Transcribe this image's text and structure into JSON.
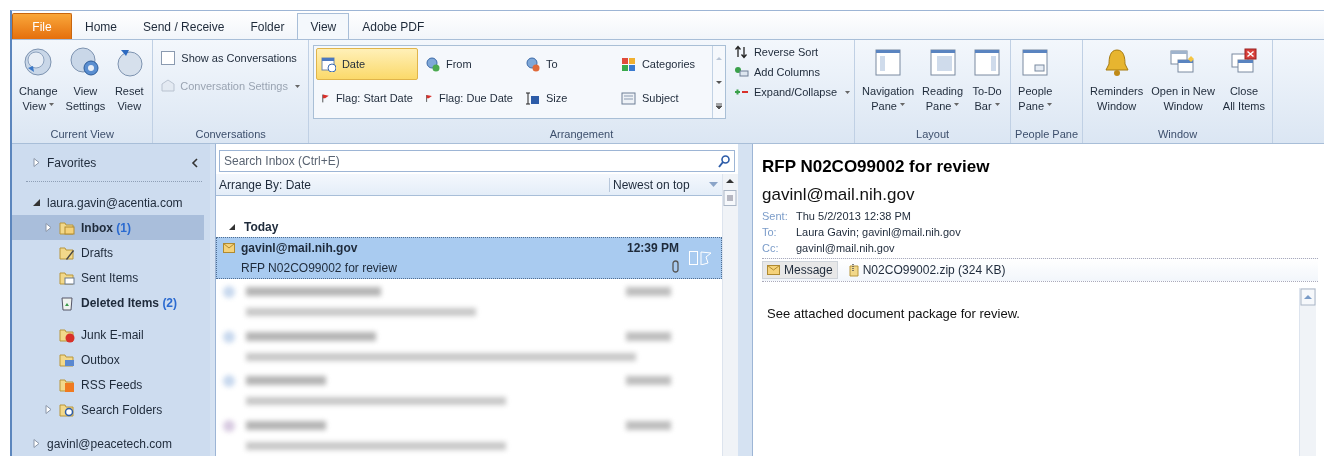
{
  "tabs": [
    {
      "label": "File",
      "selected": false,
      "kind": "file"
    },
    {
      "label": "Home",
      "selected": false,
      "kind": "tab"
    },
    {
      "label": "Send / Receive",
      "selected": false,
      "kind": "tab"
    },
    {
      "label": "Folder",
      "selected": false,
      "kind": "tab"
    },
    {
      "label": "View",
      "selected": true,
      "kind": "tab"
    },
    {
      "label": "Adobe PDF",
      "selected": false,
      "kind": "tab"
    }
  ],
  "ribbon_groups": [
    {
      "label": "Current View",
      "kind": "large",
      "buttons": [
        {
          "lines": [
            "Change",
            "View"
          ],
          "dropdown": true
        },
        {
          "lines": [
            "View",
            "Settings"
          ],
          "dropdown": false
        },
        {
          "lines": [
            "Reset",
            "View"
          ],
          "dropdown": false
        }
      ]
    },
    {
      "label": "Conversations",
      "kind": "conversations",
      "checkbox": {
        "label": "Show as Conversations",
        "checked": false
      },
      "menu": {
        "label": "Conversation Settings",
        "disabled": true,
        "dropdown": true
      }
    },
    {
      "label": "Arrangement",
      "kind": "arrangement",
      "gallery": [
        {
          "label": "Date",
          "selected": true
        },
        {
          "label": "From",
          "selected": false
        },
        {
          "label": "To",
          "selected": false
        },
        {
          "label": "Categories",
          "selected": false
        },
        {
          "label": "Flag: Start Date",
          "selected": false
        },
        {
          "label": "Flag: Due Date",
          "selected": false
        },
        {
          "label": "Size",
          "selected": false
        },
        {
          "label": "Subject",
          "selected": false
        }
      ],
      "commands": [
        {
          "label": "Reverse Sort",
          "dropdown": false
        },
        {
          "label": "Add Columns",
          "dropdown": false
        },
        {
          "label": "Expand/Collapse",
          "dropdown": true
        }
      ]
    },
    {
      "label": "Layout",
      "kind": "large",
      "buttons": [
        {
          "lines": [
            "Navigation",
            "Pane"
          ],
          "dropdown": true
        },
        {
          "lines": [
            "Reading",
            "Pane"
          ],
          "dropdown": true
        },
        {
          "lines": [
            "To-Do",
            "Bar"
          ],
          "dropdown": true
        }
      ]
    },
    {
      "label": "People Pane",
      "kind": "large",
      "buttons": [
        {
          "lines": [
            "People",
            "Pane"
          ],
          "dropdown": true
        }
      ]
    },
    {
      "label": "Window",
      "kind": "large",
      "buttons": [
        {
          "lines": [
            "Reminders",
            "Window"
          ],
          "dropdown": false
        },
        {
          "lines": [
            "Open in New",
            "Window"
          ],
          "dropdown": false
        },
        {
          "lines": [
            "Close",
            "All Items"
          ],
          "dropdown": false
        }
      ]
    }
  ],
  "navigation": [
    {
      "label": "Favorites",
      "expanded": false,
      "selected": false,
      "kind": "section"
    },
    {
      "label": "laura.gavin@acentia.com",
      "expanded": true,
      "selected": false,
      "kind": "account",
      "children": [
        {
          "label": "Inbox",
          "count": "(1)",
          "expanded": false,
          "selected": true,
          "kind": "inbox"
        },
        {
          "label": "Drafts",
          "selected": false,
          "kind": "drafts"
        },
        {
          "label": "Sent Items",
          "selected": false,
          "kind": "sent"
        },
        {
          "label": "Deleted Items",
          "count": "(2)",
          "selected": false,
          "kind": "bin"
        },
        {
          "label": "Junk E-mail",
          "selected": false,
          "kind": "junk"
        },
        {
          "label": "Outbox",
          "selected": false,
          "kind": "outbox"
        },
        {
          "label": "RSS Feeds",
          "selected": false,
          "kind": "rss"
        },
        {
          "label": "Search Folders",
          "expanded": false,
          "selected": false,
          "kind": "search"
        }
      ]
    },
    {
      "label": "gavinl@peacetech.com",
      "expanded": false,
      "selected": false,
      "kind": "account"
    }
  ],
  "message_list": {
    "search": {
      "placeholder": "Search Inbox (Ctrl+E)"
    },
    "arrange_by": "Arrange By: Date",
    "order": "Newest on top",
    "groups": [
      {
        "label": "Today",
        "expanded": true,
        "messages": [
          {
            "from": "gavinl@mail.nih.gov",
            "subject": "RFP N02CO99002 for review",
            "time": "12:39 PM",
            "unread": true,
            "attachment": true,
            "selected": true
          }
        ]
      }
    ]
  },
  "reading_pane": {
    "subject": "RFP N02CO99002 for review",
    "from": "gavinl@mail.nih.gov",
    "fields": [
      {
        "label": "Sent:",
        "value": "Thu 5/2/2013 12:38 PM"
      },
      {
        "label": "To:",
        "value": "Laura Gavin; gavinl@mail.nih.gov"
      },
      {
        "label": "Cc:",
        "value": "gavinl@mail.nih.gov"
      }
    ],
    "attachments": [
      {
        "label": "Message",
        "selected": true,
        "kind": "message"
      },
      {
        "label": "N02CO99002.zip (324 KB)",
        "selected": false,
        "kind": "zip"
      }
    ],
    "body": "See attached document package for review."
  }
}
